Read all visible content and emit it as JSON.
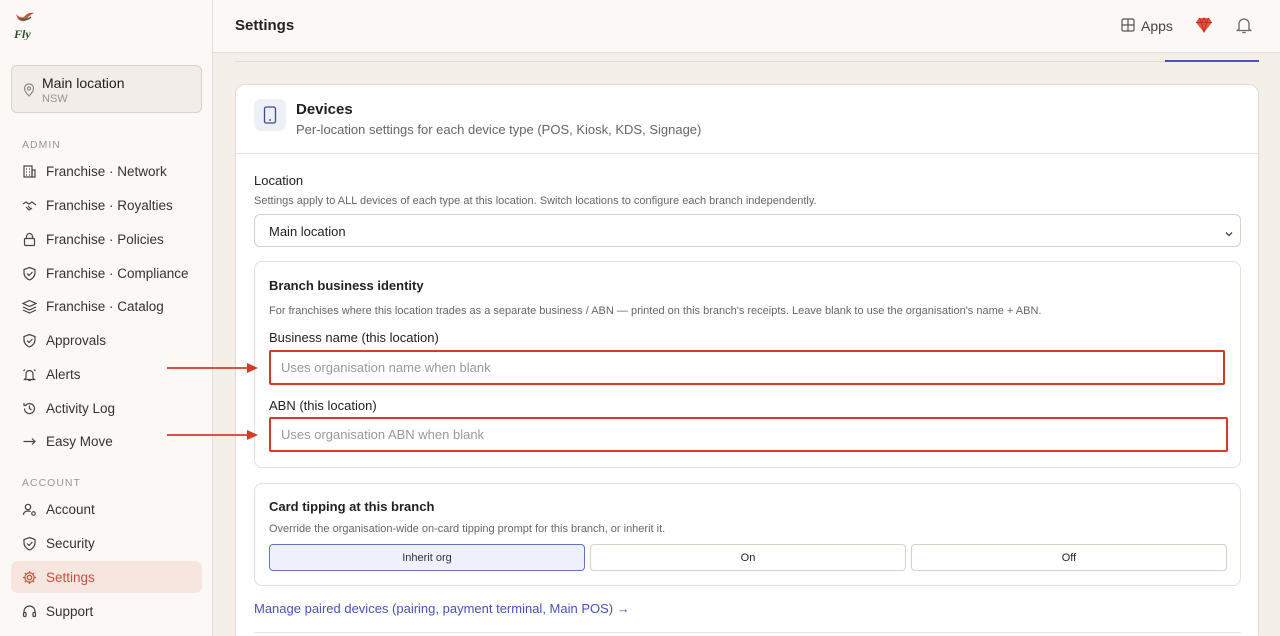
{
  "brand": {
    "logo_text": "Fly",
    "accent": "#c4523d",
    "link_color": "#4b4fb8",
    "annotation_color": "#d63b2a"
  },
  "sidebar": {
    "location": {
      "name": "Main location",
      "state": "NSW",
      "icon": "pin-icon"
    },
    "admin_label": "ADMIN",
    "admin_items": [
      {
        "label": "Franchise · Network",
        "icon": "building-icon"
      },
      {
        "label": "Franchise · Royalties",
        "icon": "handshake-icon"
      },
      {
        "label": "Franchise · Policies",
        "icon": "lock-icon"
      },
      {
        "label": "Franchise · Compliance",
        "icon": "shield-check-icon"
      },
      {
        "label": "Franchise · Catalog",
        "icon": "catalog-icon"
      },
      {
        "label": "Approvals",
        "icon": "shield-check-icon"
      },
      {
        "label": "Alerts",
        "icon": "bell-alert-icon"
      },
      {
        "label": "Activity Log",
        "icon": "history-icon"
      },
      {
        "label": "Easy Move",
        "icon": "arrow-right-icon"
      }
    ],
    "account_label": "ACCOUNT",
    "account_items": [
      {
        "label": "Account",
        "icon": "user-cog-icon"
      },
      {
        "label": "Security",
        "icon": "shield-icon"
      },
      {
        "label": "Settings",
        "icon": "gear-icon",
        "active": true
      },
      {
        "label": "Support",
        "icon": "headset-icon"
      }
    ]
  },
  "header": {
    "title": "Settings",
    "apps_label": "Apps"
  },
  "devices": {
    "title": "Devices",
    "subtitle": "Per-location settings for each device type (POS, Kiosk, KDS, Signage)",
    "location_label": "Location",
    "location_help": "Settings apply to ALL devices of each type at this location. Switch locations to configure each branch independently.",
    "location_value": "Main location"
  },
  "identity": {
    "title": "Branch business identity",
    "help": "For franchises where this location trades as a separate business / ABN — printed on this branch's receipts. Leave blank to use the organisation's name + ABN.",
    "business_label": "Business name (this location)",
    "business_placeholder": "Uses organisation name when blank",
    "business_value": "",
    "abn_label": "ABN (this location)",
    "abn_placeholder": "Uses organisation ABN when blank",
    "abn_value": ""
  },
  "tipping": {
    "title": "Card tipping at this branch",
    "help": "Override the organisation-wide on-card tipping prompt for this branch, or inherit it.",
    "options": [
      "Inherit org",
      "On",
      "Off"
    ],
    "selected": "Inherit org"
  },
  "manage_link": "Manage paired devices (pairing, payment terminal, Main POS) →"
}
